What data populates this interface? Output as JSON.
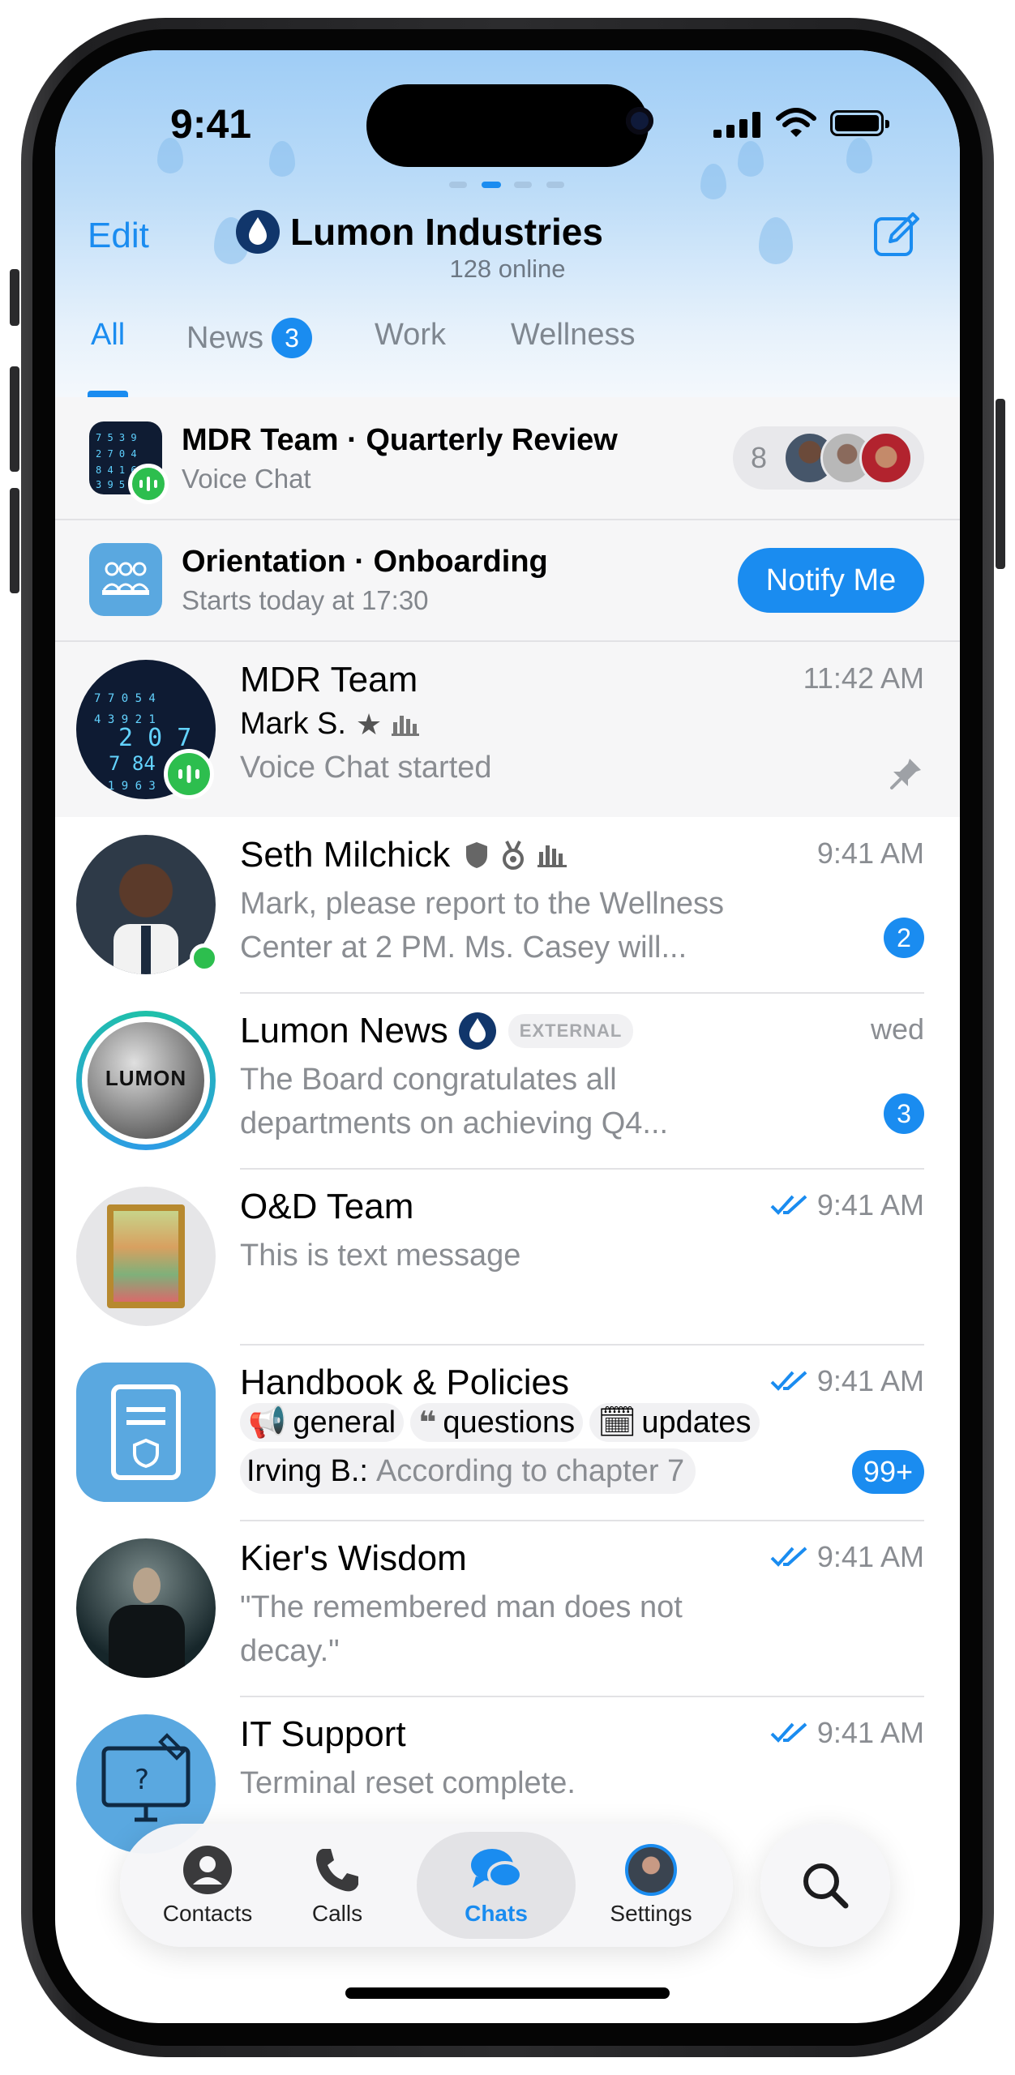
{
  "status_bar": {
    "time": "9:41"
  },
  "header": {
    "edit_label": "Edit",
    "title": "Lumon Industries",
    "subtitle": "128 online",
    "accent": "#1a8cf0"
  },
  "tabs": [
    {
      "label": "All",
      "active": true
    },
    {
      "label": "News",
      "badge": "3"
    },
    {
      "label": "Work"
    },
    {
      "label": "Wellness"
    }
  ],
  "voice_banner": {
    "title": "MDR Team · Quarterly Review",
    "subtitle": "Voice Chat",
    "participant_count": "8"
  },
  "event_banner": {
    "title": "Orientation · Onboarding",
    "subtitle": "Starts today at 17:30",
    "button_label": "Notify Me"
  },
  "chats": [
    {
      "name": "MDR Team",
      "time": "11:42 AM",
      "sender": "Mark S.",
      "message": "Voice Chat started",
      "pinned": true,
      "avatar_icon": "numbers-screen-icon"
    },
    {
      "name": "Seth Milchick",
      "time": "9:41 AM",
      "message": "Mark, please report to the Wellness Center at 2 PM. Ms. Casey will...",
      "badge": "2",
      "online": true
    },
    {
      "name": "Lumon News",
      "time": "wed",
      "tag": "EXTERNAL",
      "message": "The Board congratulates all departments on achieving Q4...",
      "badge": "3",
      "avatar_text": "LUMON"
    },
    {
      "name": "O&D Team",
      "time": "9:41 AM",
      "message": "This is text message",
      "read": true
    },
    {
      "name": "Handbook & Policies",
      "time": "9:41 AM",
      "topics": [
        "general",
        "questions",
        "updates"
      ],
      "preview_sender": "Irving B.:",
      "preview_text": "According to chapter 7",
      "badge": "99+",
      "read": true
    },
    {
      "name": "Kier's Wisdom",
      "time": "9:41 AM",
      "message": "\"The remembered man does not decay.\"",
      "read": true
    },
    {
      "name": "IT Support",
      "time": "9:41 AM",
      "message": "Terminal reset complete.",
      "read": true
    }
  ],
  "tabbar": {
    "items": [
      {
        "label": "Contacts",
        "icon": "person-icon"
      },
      {
        "label": "Calls",
        "icon": "phone-icon"
      },
      {
        "label": "Chats",
        "icon": "chat-bubbles-icon",
        "active": true
      },
      {
        "label": "Settings",
        "icon": "avatar-icon"
      }
    ],
    "search_icon": "search-icon"
  }
}
